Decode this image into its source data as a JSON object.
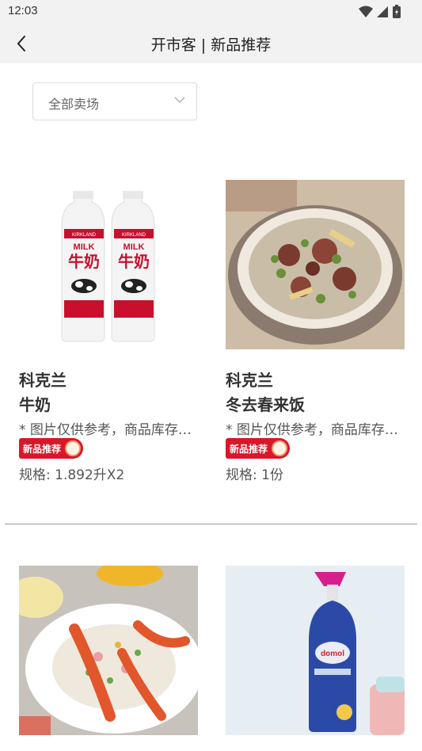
{
  "status_bar": {
    "time": "12:03"
  },
  "header": {
    "back_icon": "chevron-left-icon",
    "title": "开市客 | 新品推荐"
  },
  "filter": {
    "label": "全部卖场",
    "icon": "chevron-down-icon"
  },
  "products": [
    {
      "brand": "科克兰",
      "name": "牛奶",
      "note": "* 图片仅供参考，商品库存及价格以门店为准",
      "badge": "新品推荐",
      "spec": "规格: 1.892升X2",
      "image": "milk-bottles"
    },
    {
      "brand": "科克兰",
      "name": "冬去春来饭",
      "note": "* 图片仅供参考，商品库存及价格以门店为准",
      "badge": "新品推荐",
      "spec": "规格: 1份",
      "image": "claypot-rice"
    },
    {
      "image": "potato-salad"
    },
    {
      "image": "cleaning-spray"
    }
  ],
  "images": {
    "milk_brand": "KIRKLAND",
    "milk_label": "MILK",
    "milk_cn": "牛奶",
    "spray_brand": "domol"
  },
  "colors": {
    "accent": "#d9172a",
    "nav_bg": "#f2f2f2"
  }
}
